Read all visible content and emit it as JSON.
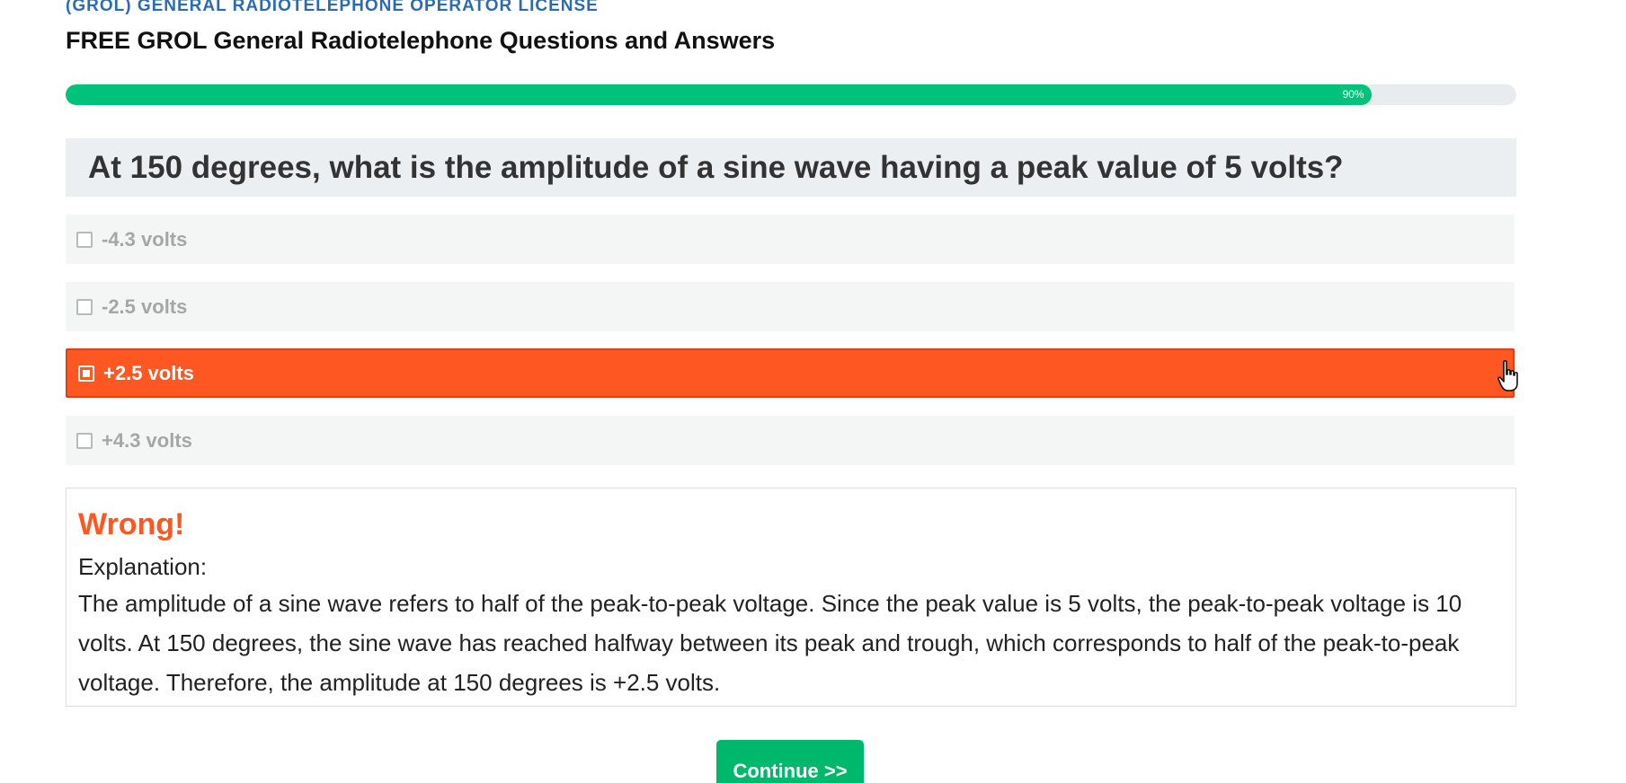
{
  "header": {
    "category": "(GROL) GENERAL RADIOTELEPHONE OPERATOR LICENSE",
    "title": "FREE GROL General Radiotelephone Questions and Answers"
  },
  "progress": {
    "percent": 90,
    "label": "90%",
    "fill_color": "#00c27a"
  },
  "question": {
    "text": "At 150 degrees, what is the amplitude of a sine wave having a peak value of 5 volts?"
  },
  "answers": [
    {
      "label": "-4.3 volts",
      "selected": false
    },
    {
      "label": "-2.5 volts",
      "selected": false
    },
    {
      "label": "+2.5 volts",
      "selected": true
    },
    {
      "label": "+4.3 volts",
      "selected": false
    }
  ],
  "feedback": {
    "verdict": "Wrong!",
    "explanation_label": "Explanation:",
    "explanation_text": "The amplitude of a sine wave refers to half of the peak-to-peak voltage. Since the peak value is 5 volts, the peak-to-peak voltage is 10 volts. At 150 degrees, the sine wave has reached halfway between its peak and trough, which corresponds to half of the peak-to-peak voltage. Therefore, the amplitude at 150 degrees is +2.5 volts.",
    "verdict_color": "#ff5722"
  },
  "actions": {
    "continue_label": "Continue >>"
  },
  "colors": {
    "accent_selected": "#ff5722",
    "success": "#00b86b",
    "category_blue": "#2b6cb0"
  },
  "icons": {
    "cursor": "hand-pointer-icon",
    "checkbox": "checkbox-icon"
  }
}
